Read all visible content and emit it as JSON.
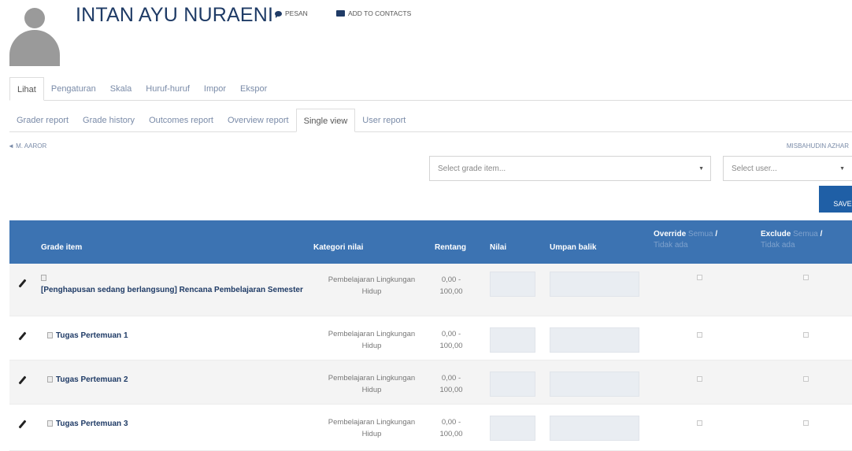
{
  "user": {
    "name": "INTAN AYU NURAENI"
  },
  "header_links": {
    "message": "PESAN",
    "add_contact": "ADD TO CONTACTS"
  },
  "nav_primary": [
    {
      "label": "Lihat",
      "active": true
    },
    {
      "label": "Pengaturan",
      "active": false
    },
    {
      "label": "Skala",
      "active": false
    },
    {
      "label": "Huruf-huruf",
      "active": false
    },
    {
      "label": "Impor",
      "active": false
    },
    {
      "label": "Ekspor",
      "active": false
    }
  ],
  "nav_secondary": [
    {
      "label": "Grader report",
      "active": false
    },
    {
      "label": "Grade history",
      "active": false
    },
    {
      "label": "Outcomes report",
      "active": false
    },
    {
      "label": "Overview report",
      "active": false
    },
    {
      "label": "Single view",
      "active": true
    },
    {
      "label": "User report",
      "active": false
    }
  ],
  "prev_user": "◄ M. AAROR",
  "next_user": "MISBAHUDIN AZHAR",
  "selects": {
    "grade_item": "Select grade item...",
    "user": "Select user..."
  },
  "save_label": "SAVE",
  "table": {
    "headers": {
      "grade_item": "Grade item",
      "category": "Kategori nilai",
      "range": "Rentang",
      "value": "Nilai",
      "feedback": "Umpan balik",
      "override": "Override",
      "override_extra": "Semua",
      "override_sub": "Tidak ada",
      "exclude": "Exclude",
      "exclude_extra": "Semua",
      "exclude_sub": "Tidak ada",
      "separator": "/"
    },
    "rows": [
      {
        "grade_item": "[Penghapusan sedang berlangsung] Rencana Pembelajaran Semester",
        "category_line1": "Pembelajaran Lingkungan",
        "category_line2": "Hidup",
        "range_line1": "0,00 -",
        "range_line2": "100,00"
      },
      {
        "grade_item": "Tugas Pertemuan 1",
        "category_line1": "Pembelajaran Lingkungan",
        "category_line2": "Hidup",
        "range_line1": "0,00 -",
        "range_line2": "100,00"
      },
      {
        "grade_item": "Tugas Pertemuan 2",
        "category_line1": "Pembelajaran Lingkungan",
        "category_line2": "Hidup",
        "range_line1": "0,00 -",
        "range_line2": "100,00"
      },
      {
        "grade_item": "Tugas Pertemuan 3",
        "category_line1": "Pembelajaran Lingkungan",
        "category_line2": "Hidup",
        "range_line1": "0,00 -",
        "range_line2": "100,00"
      }
    ]
  },
  "icons": {
    "avatar": "user-avatar-icon",
    "message": "chat-bubble-icon",
    "contact": "address-card-icon",
    "edit": "pencil-icon",
    "grade_item": "document-icon",
    "select": "caret-down-icon"
  },
  "colors": {
    "name": "#1f3b66",
    "table_header": "#3c73b2",
    "save_button": "#1f5fa6",
    "link": "#7a8ba8"
  }
}
